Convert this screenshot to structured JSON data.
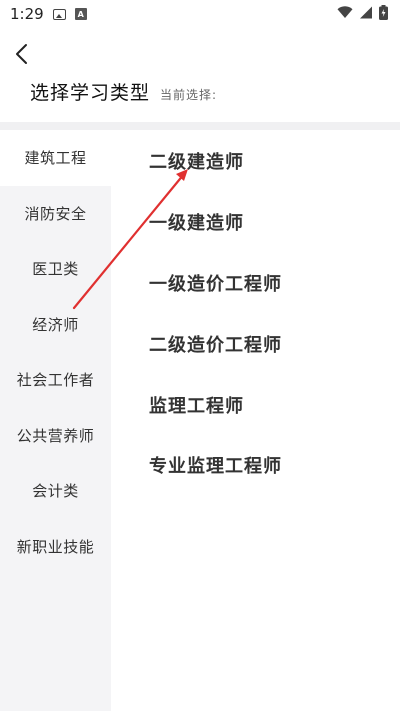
{
  "status_bar": {
    "time": "1:29"
  },
  "header": {
    "title": "选择学习类型",
    "current_label": "当前选择:"
  },
  "sidebar": {
    "items": [
      {
        "label": "建筑工程"
      },
      {
        "label": "消防安全"
      },
      {
        "label": "医卫类"
      },
      {
        "label": "经济师"
      },
      {
        "label": "社会工作者"
      },
      {
        "label": "公共营养师"
      },
      {
        "label": "会计类"
      },
      {
        "label": "新职业技能"
      }
    ]
  },
  "courses": [
    {
      "label": "二级建造师"
    },
    {
      "label": "一级建造师"
    },
    {
      "label": "一级造价工程师"
    },
    {
      "label": "二级造价工程师"
    },
    {
      "label": "监理工程师"
    },
    {
      "label": "专业监理工程师"
    }
  ],
  "colors": {
    "annotation_arrow": "#e03030",
    "sidebar_bg": "#f4f4f6"
  }
}
